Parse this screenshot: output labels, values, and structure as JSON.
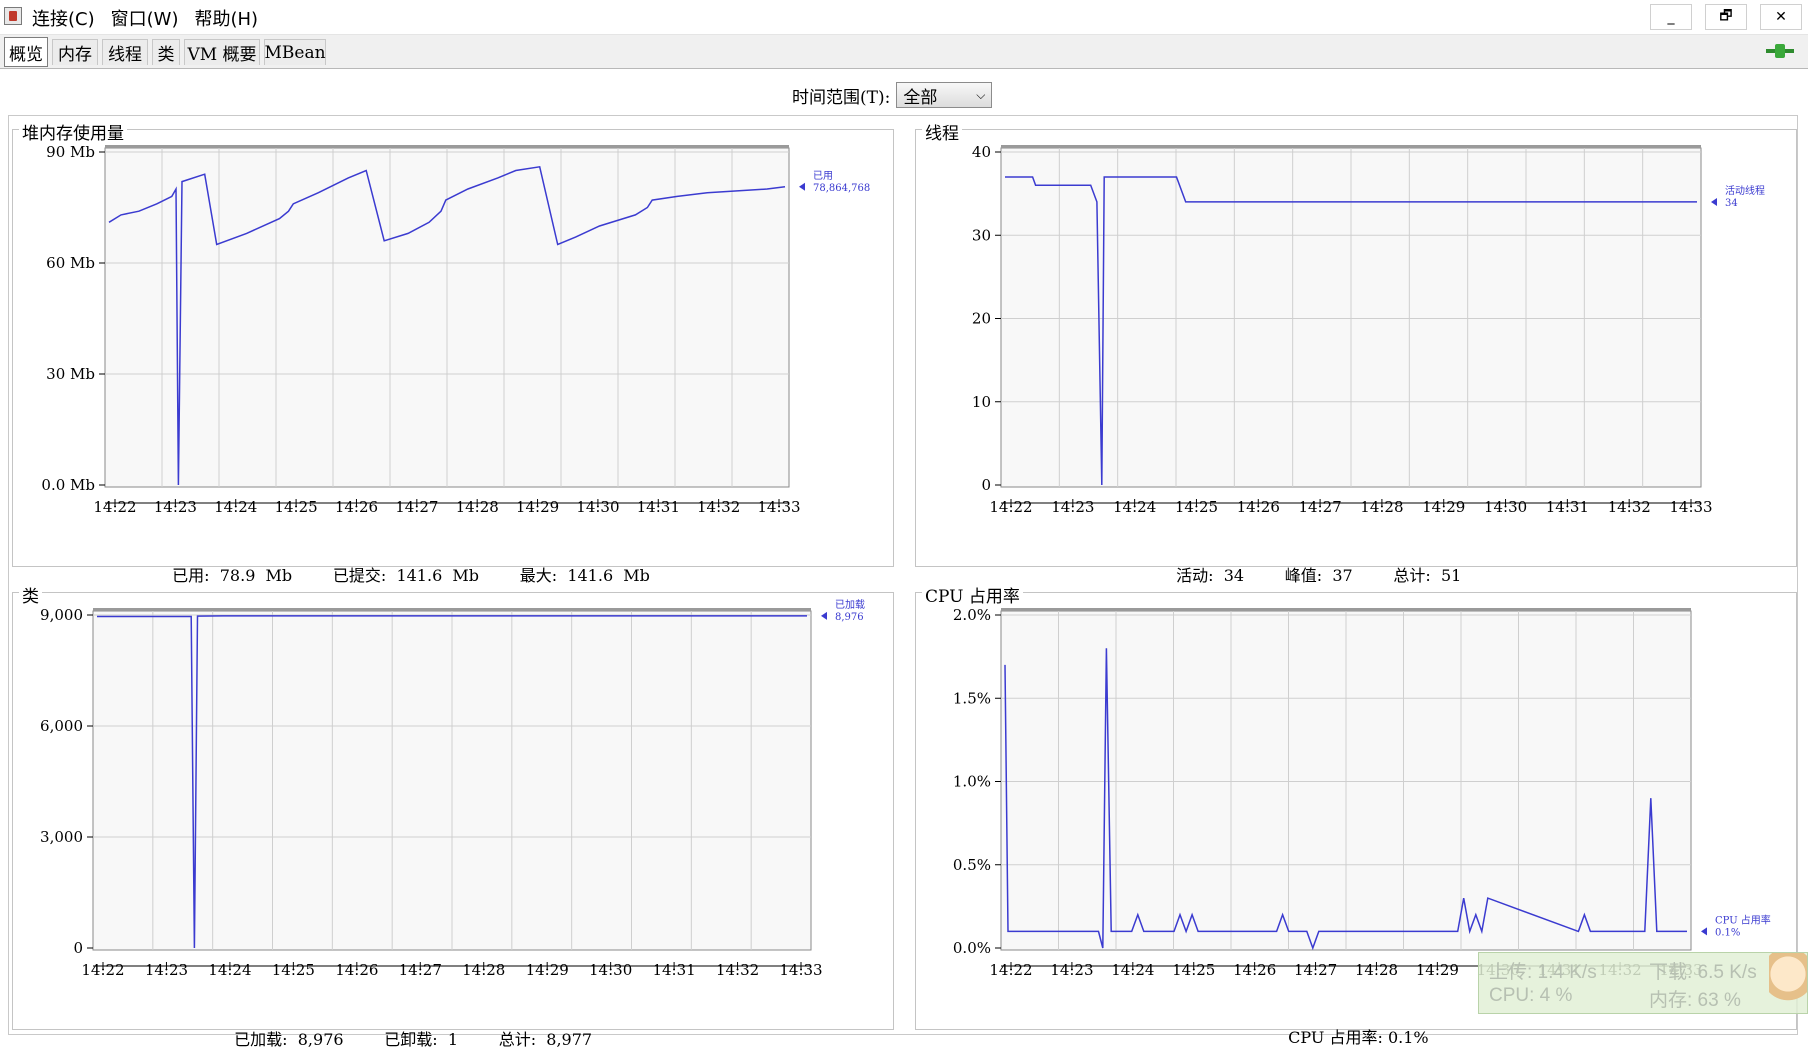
{
  "window": {
    "menus": [
      "连接(C)",
      "窗口(W)",
      "帮助(H)"
    ],
    "controls": {
      "minimize": "_",
      "restore": "🗗",
      "close": "✕"
    }
  },
  "tabs": [
    "概览",
    "内存",
    "线程",
    "类",
    "VM 概要",
    "MBean"
  ],
  "time_range": {
    "label": "时间范围(T):",
    "value": "全部"
  },
  "x_ticks": [
    "14:22",
    "14:23",
    "14:24",
    "14:25",
    "14:26",
    "14:27",
    "14:28",
    "14:29",
    "14:30",
    "14:31",
    "14:32",
    "14:33"
  ],
  "panels": {
    "heap": {
      "title": "堆内存使用量",
      "stats": [
        {
          "label": "已用:",
          "value": "78.9  Mb"
        },
        {
          "label": "已提交:",
          "value": "141.6  Mb"
        },
        {
          "label": "最大:",
          "value": "141.6  Mb"
        }
      ],
      "legend": {
        "name": "已用",
        "value": "78,864,768"
      }
    },
    "threads": {
      "title": "线程",
      "stats": [
        {
          "label": "活动:",
          "value": "34"
        },
        {
          "label": "峰值:",
          "value": "37"
        },
        {
          "label": "总计:",
          "value": "51"
        }
      ],
      "legend": {
        "name": "活动线程",
        "value": "34"
      }
    },
    "classes": {
      "title": "类",
      "stats": [
        {
          "label": "已加载:",
          "value": "8,976"
        },
        {
          "label": "已卸载:",
          "value": "1"
        },
        {
          "label": "总计:",
          "value": "8,977"
        }
      ],
      "legend": {
        "name": "已加载",
        "value": "8,976"
      }
    },
    "cpu": {
      "title": "CPU 占用率",
      "stats": [
        {
          "label": "CPU 占用率:",
          "value": "0.1%"
        }
      ],
      "legend": {
        "name": "CPU 占用率",
        "value": "0.1%"
      }
    }
  },
  "net_widget": {
    "upload": "上传: 1.4 K/s",
    "download": "下载: 6.5 K/s",
    "cpu": "CPU: 4 %",
    "mem": "内存: 63 %"
  },
  "colors": {
    "series": "#3b3bd0",
    "grid": "#cfcfcf",
    "plot_bg": "#f8f8f8"
  },
  "chart_data": [
    {
      "type": "line",
      "title": "堆内存使用量",
      "xlabel": "",
      "ylabel": "",
      "x": [
        0,
        0.2,
        0.5,
        0.8,
        1.05,
        1.12,
        1.16,
        1.22,
        1.6,
        1.8,
        2.3,
        2.85,
        3.0,
        3.08,
        3.5,
        4.0,
        4.3,
        4.6,
        5.0,
        5.35,
        5.55,
        5.63,
        6.0,
        6.5,
        6.8,
        7.2,
        7.5,
        7.8,
        8.2,
        8.8,
        9.0,
        9.08,
        9.5,
        10.0,
        10.5,
        11.0,
        11.3
      ],
      "series": [
        {
          "name": "已用",
          "values": [
            71,
            73,
            74,
            76,
            78,
            80,
            0,
            82,
            84,
            65,
            68,
            72,
            74,
            76,
            79,
            83,
            85,
            66,
            68,
            71,
            74,
            77,
            80,
            83,
            85,
            86,
            65,
            67,
            70,
            73,
            75,
            77,
            78,
            79,
            79.5,
            80,
            80.6
          ]
        }
      ],
      "yticks": [
        "0.0 Mb",
        "30 Mb",
        "60 Mb",
        "90 Mb"
      ],
      "ylim": [
        0,
        90
      ]
    },
    {
      "type": "line",
      "title": "线程",
      "xlabel": "",
      "ylabel": "",
      "x": [
        0,
        0.45,
        0.5,
        1.4,
        1.5,
        1.58,
        1.62,
        1.7,
        2.8,
        2.95,
        11.3
      ],
      "series": [
        {
          "name": "活动线程",
          "values": [
            37,
            37,
            36,
            36,
            34,
            0,
            37,
            37,
            37,
            34,
            34
          ]
        }
      ],
      "yticks": [
        "0",
        "10",
        "20",
        "30",
        "40"
      ],
      "ylim": [
        0,
        40
      ]
    },
    {
      "type": "line",
      "title": "类",
      "xlabel": "",
      "ylabel": "",
      "x": [
        0,
        1.5,
        1.55,
        1.6,
        2.0,
        11.3
      ],
      "series": [
        {
          "name": "已加载",
          "values": [
            8960,
            8960,
            0,
            8970,
            8976,
            8976
          ]
        }
      ],
      "yticks": [
        "0",
        "3,000",
        "6,000",
        "9,000"
      ],
      "ylim": [
        0,
        9000
      ]
    },
    {
      "type": "line",
      "title": "CPU 占用率",
      "xlabel": "",
      "ylabel": "",
      "x": [
        0,
        0.05,
        1.55,
        1.62,
        1.68,
        1.76,
        2.1,
        2.2,
        2.3,
        2.8,
        2.9,
        3.0,
        3.1,
        3.2,
        3.3,
        4.5,
        4.6,
        4.7,
        5.0,
        5.1,
        5.2,
        7.5,
        7.6,
        7.7,
        7.8,
        7.9,
        8.0,
        9.5,
        9.6,
        9.7,
        10.6,
        10.7,
        10.8,
        11.3
      ],
      "series": [
        {
          "name": "CPU 占用率",
          "values": [
            1.7,
            0.1,
            0.1,
            0.0,
            1.8,
            0.1,
            0.1,
            0.2,
            0.1,
            0.1,
            0.2,
            0.1,
            0.2,
            0.1,
            0.1,
            0.1,
            0.2,
            0.1,
            0.1,
            0.0,
            0.1,
            0.1,
            0.3,
            0.1,
            0.2,
            0.1,
            0.3,
            0.1,
            0.2,
            0.1,
            0.1,
            0.9,
            0.1,
            0.1
          ]
        }
      ],
      "yticks": [
        "0.0%",
        "0.5%",
        "1.0%",
        "1.5%",
        "2.0%"
      ],
      "ylim": [
        0,
        2.0
      ]
    }
  ]
}
